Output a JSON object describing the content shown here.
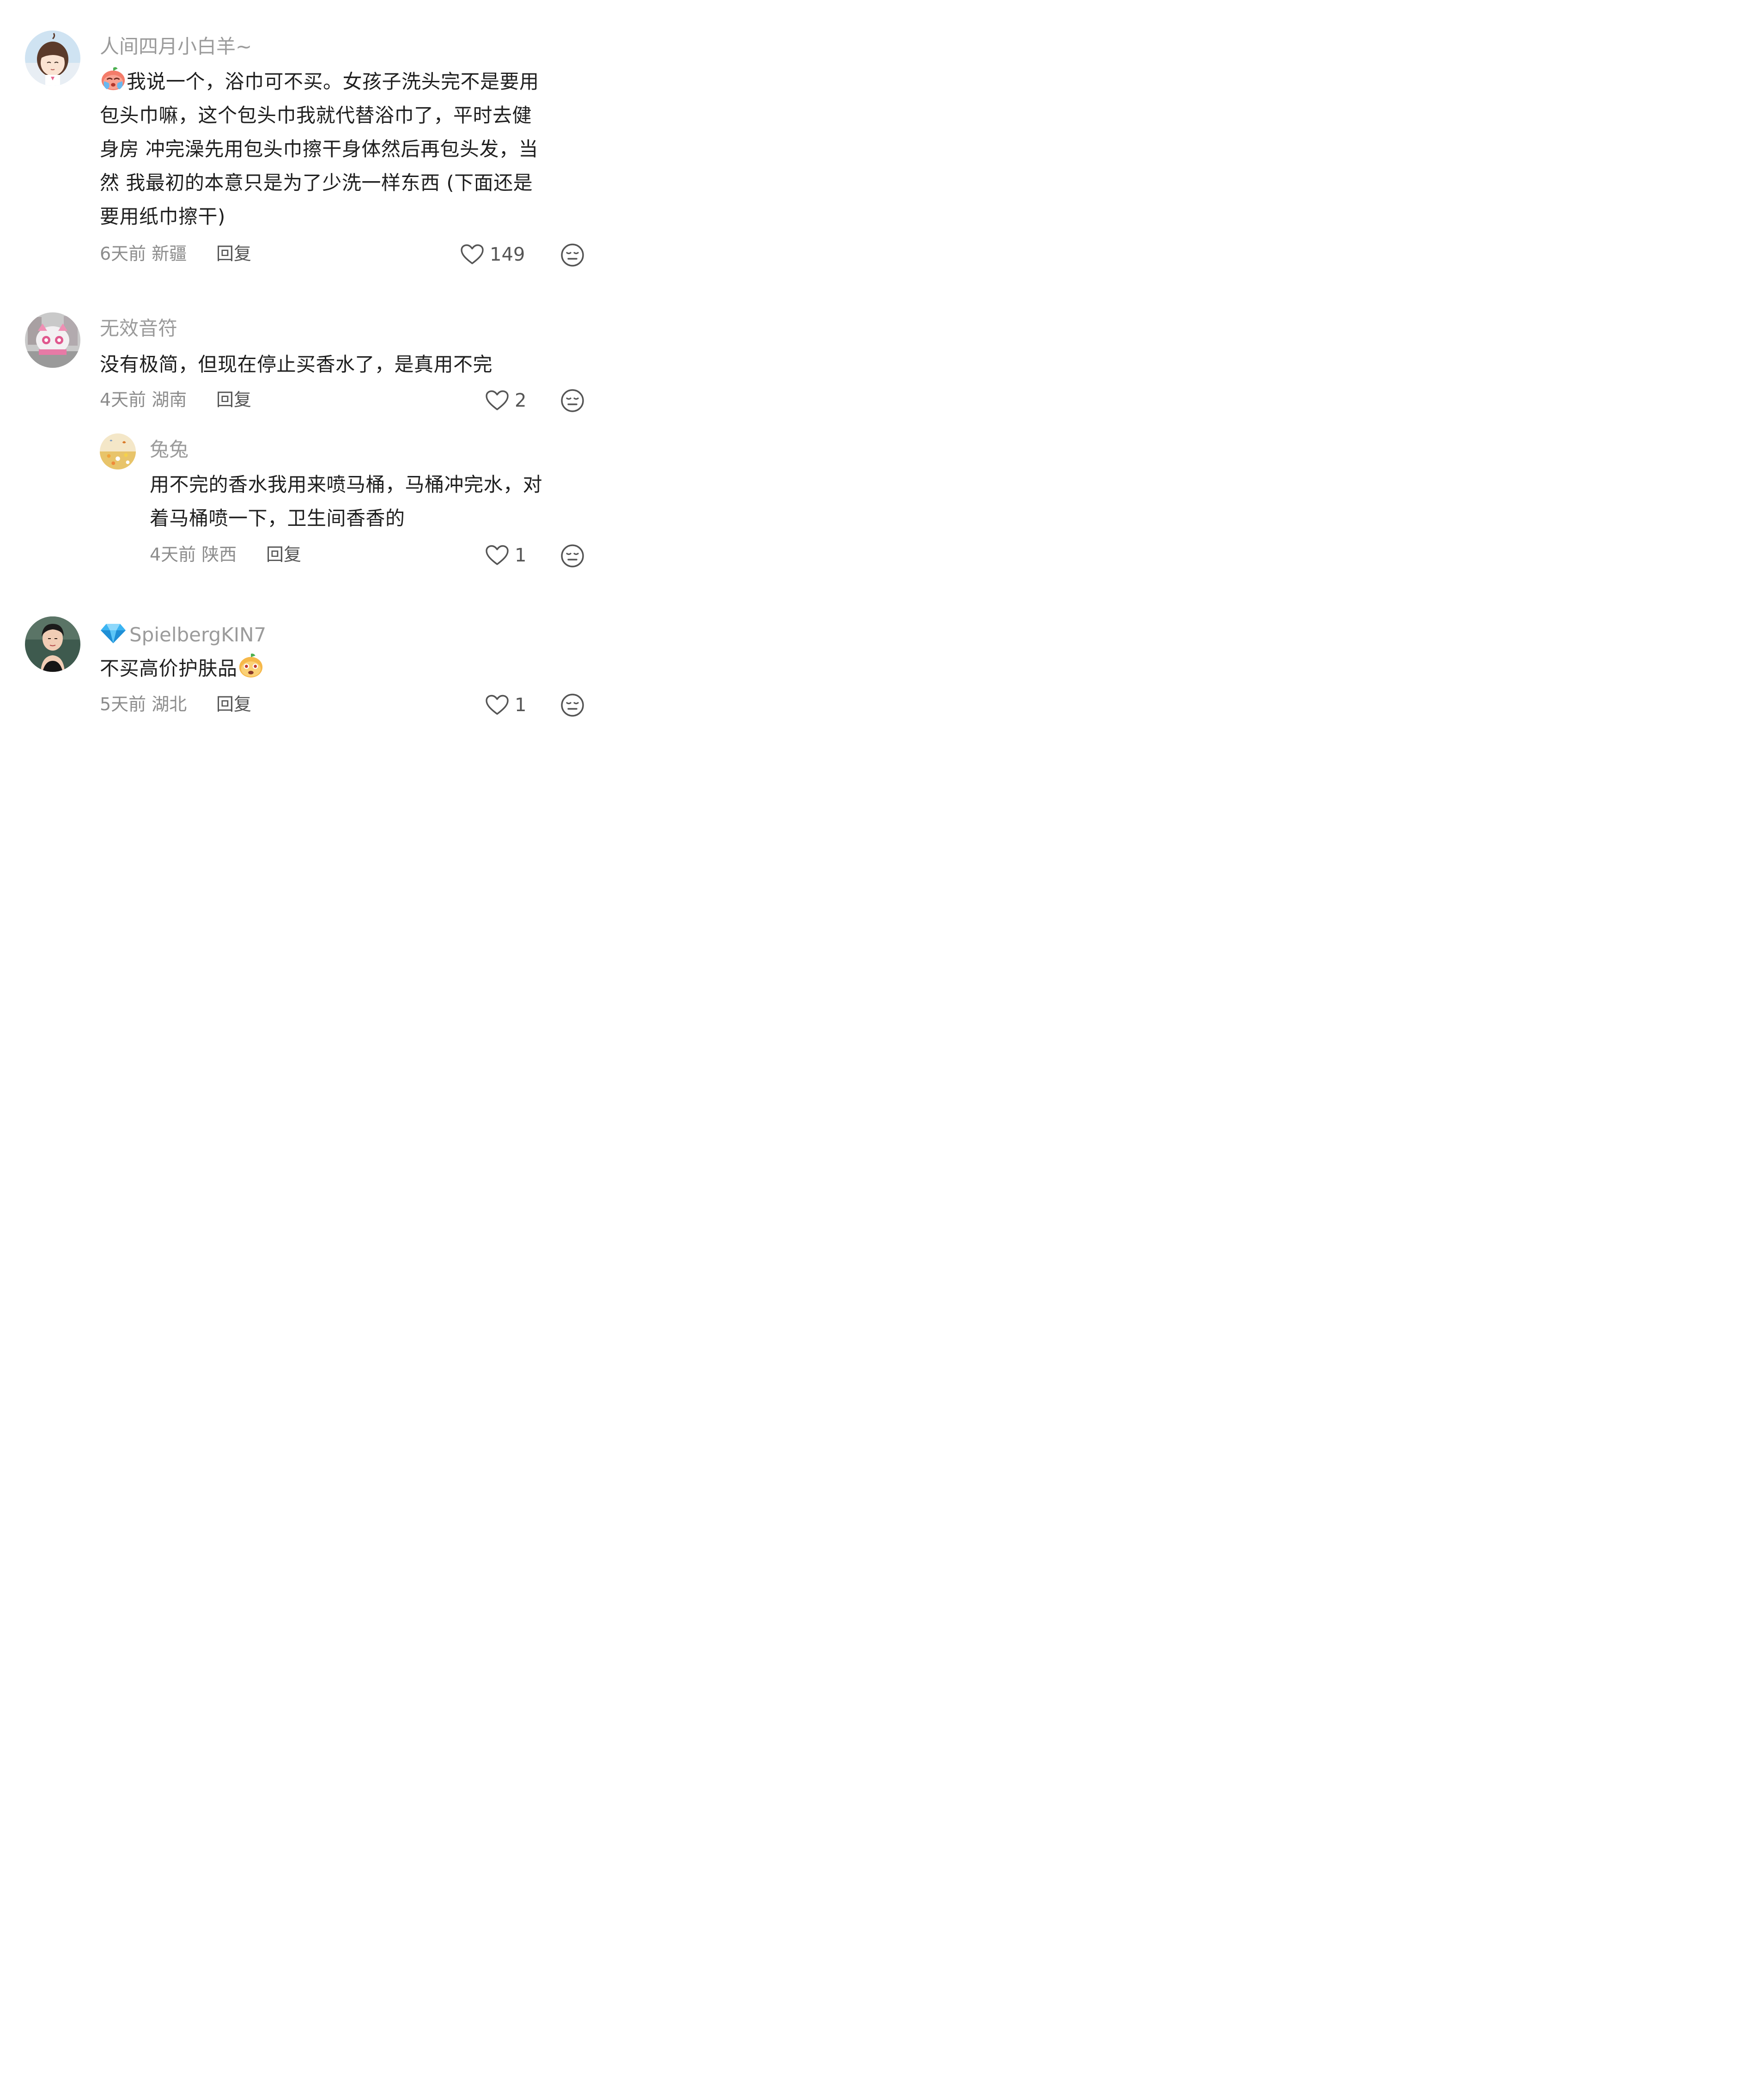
{
  "comments": [
    {
      "username": "人间四月小白羊~",
      "text_line1": "我说一个，浴巾可不买。女孩子洗头完不是要用",
      "text_line2": "包头巾嘛，这个包头巾我就代替浴巾了，平时去健",
      "text_line3": "身房 冲完澡先用包头巾擦干身体然后再包头发，当",
      "text_line4": "然 我最初的本意只是为了少洗一样东西 (下面还是",
      "text_line5": "要用纸巾擦干)",
      "leading_emoji": "crying-peach-emoji",
      "time": "6天前",
      "location": "新疆",
      "reply_label": "回复",
      "likes": "149"
    },
    {
      "username": "无效音符",
      "text_line1": "没有极简，但现在停止买香水了，是真用不完",
      "time": "4天前",
      "location": "湖南",
      "reply_label": "回复",
      "likes": "2",
      "replies": [
        {
          "username": "兔兔",
          "text_line1": "用不完的香水我用来喷马桶，马桶冲完水，对",
          "text_line2": "着马桶喷一下，卫生间香香的",
          "time": "4天前",
          "location": "陕西",
          "reply_label": "回复",
          "likes": "1"
        }
      ]
    },
    {
      "username": "SpielbergKIN7",
      "badge": "diamond-icon",
      "text_line1": "不买高价护肤品",
      "trailing_emoji": "peach-face-emoji",
      "time": "5天前",
      "location": "湖北",
      "reply_label": "回复",
      "likes": "1"
    }
  ],
  "colors": {
    "username": "#9b9b9b",
    "meta": "#8c8c8c",
    "text": "#1f1f1f",
    "icon": "#555555"
  }
}
